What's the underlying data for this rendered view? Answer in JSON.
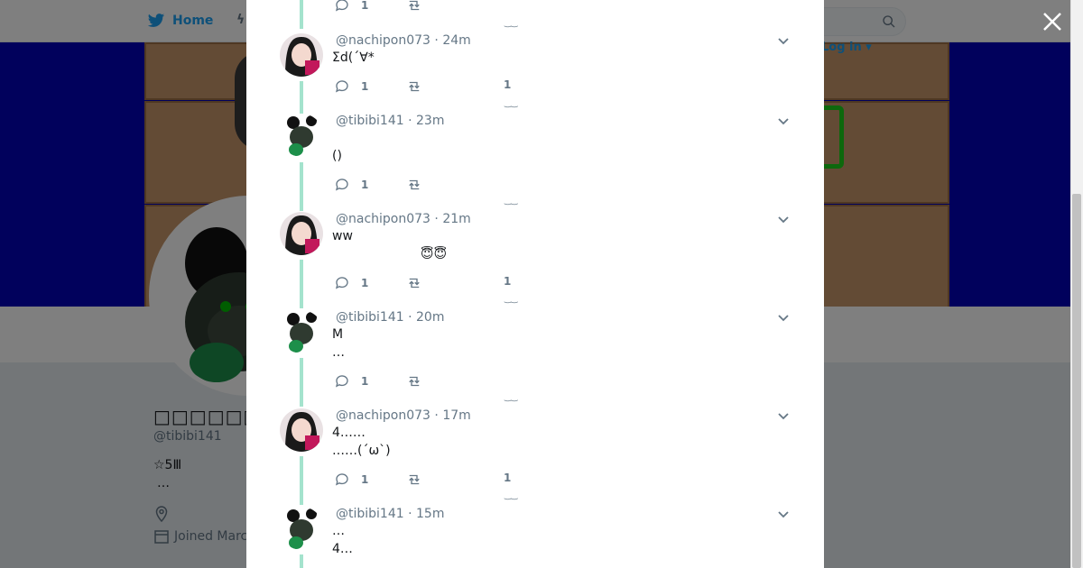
{
  "topbar": {
    "home_label": "Home",
    "login_label": "Log in"
  },
  "background_profile": {
    "display_name": "□□□□□□□□□□",
    "handle": "@tibibi141",
    "bio_line1": "☆5Ⅲ",
    "bio_line2": "…",
    "joined": "Joined Marc"
  },
  "tweets": [
    {
      "handle": "",
      "time": "",
      "text": "",
      "replies": "1",
      "likes": ""
    },
    {
      "handle": "@nachipon073",
      "time": "24m",
      "text": "Σd(´∀*",
      "replies": "1",
      "likes": "1"
    },
    {
      "handle": "@tibibi141",
      "time": "23m",
      "text": "\n()",
      "replies": "1",
      "likes": ""
    },
    {
      "handle": "@nachipon073",
      "time": "21m",
      "text": "ww\n                      😇😇",
      "replies": "1",
      "likes": "1"
    },
    {
      "handle": "@tibibi141",
      "time": "20m",
      "text": "M\n…",
      "replies": "1",
      "likes": ""
    },
    {
      "handle": "@nachipon073",
      "time": "17m",
      "text": "4……\n……(´ω`)",
      "replies": "1",
      "likes": "1"
    },
    {
      "handle": "@tibibi141",
      "time": "15m",
      "text": "…\n4…",
      "replies": "",
      "likes": ""
    }
  ],
  "colors": {
    "accent": "#1da1f2",
    "thread_line": "#a4e3cd",
    "banner": "#0202b8"
  }
}
